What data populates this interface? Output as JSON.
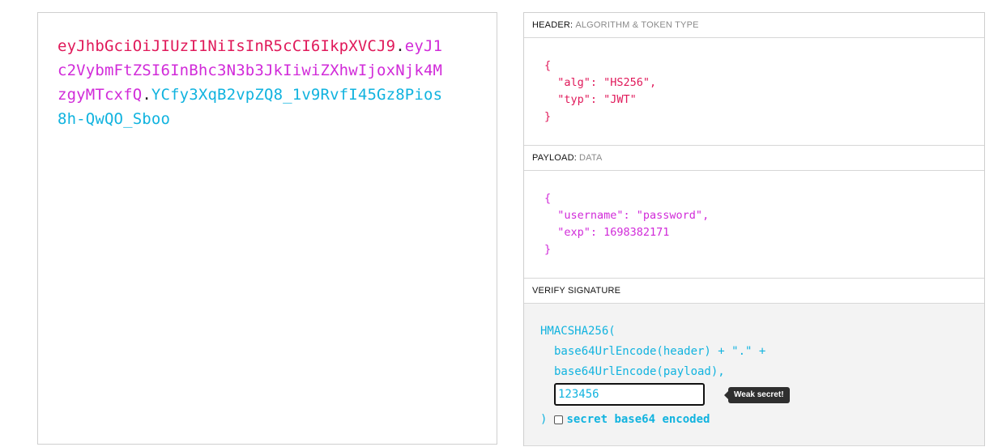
{
  "encoded": {
    "header": "eyJhbGciOiJIUzI1NiIsInR5cCI6IkpXVCJ9",
    "payload": "eyJ1c2VybmFtZSI6InBhc3N3b3JkIiwiZXhwIjoxNjk4MzgyMTcxfQ",
    "signature": "YCfy3XqB2vpZQ8_1v9RvfI45Gz8Pios8h-QwQO_Sboo",
    "dot": "."
  },
  "header_section": {
    "title": "HEADER:",
    "subtitle": "ALGORITHM & TOKEN TYPE",
    "lines": [
      "{",
      "  \"alg\": \"HS256\",",
      "  \"typ\": \"JWT\"",
      "}"
    ]
  },
  "payload_section": {
    "title": "PAYLOAD:",
    "subtitle": "DATA",
    "lines": [
      "{",
      "  \"username\": \"password\",",
      "  \"exp\": 1698382171",
      "}"
    ]
  },
  "verify_section": {
    "title": "VERIFY SIGNATURE",
    "line1": "HMACSHA256(",
    "line2": "base64UrlEncode(header) + \".\" +",
    "line3": "base64UrlEncode(payload),",
    "secret_value": "123456",
    "tooltip": "Weak secret!",
    "close": ")",
    "checkbox_label": "secret base64 encoded"
  },
  "colors": {
    "header": "#e0195a",
    "payload": "#d12bd9",
    "signature": "#11b3df"
  }
}
